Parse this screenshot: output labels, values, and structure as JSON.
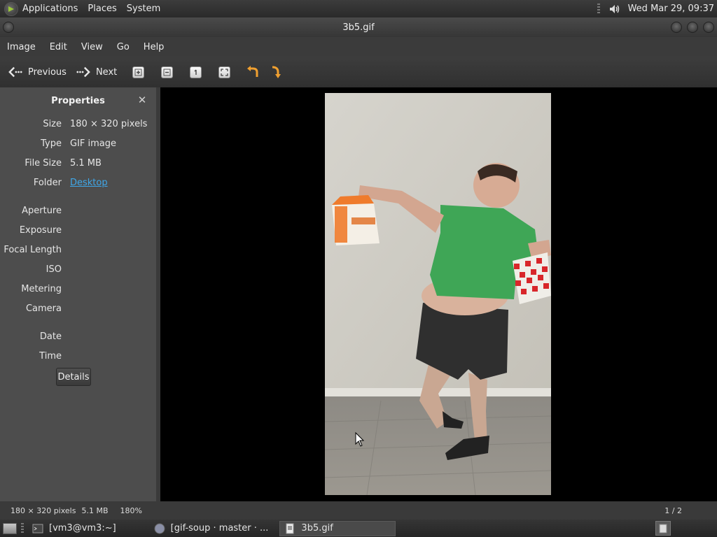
{
  "top_panel": {
    "menus": [
      "Applications",
      "Places",
      "System"
    ],
    "clock": "Wed Mar 29, 09:37"
  },
  "window": {
    "title": "3b5.gif"
  },
  "menubar": [
    "Image",
    "Edit",
    "View",
    "Go",
    "Help"
  ],
  "toolbar": {
    "previous_label": "Previous",
    "next_label": "Next"
  },
  "sidebar": {
    "header": "Properties",
    "properties": [
      {
        "key": "Size",
        "value": "180 × 320 pixels"
      },
      {
        "key": "Type",
        "value": "GIF image"
      },
      {
        "key": "File Size",
        "value": "5.1 MB"
      },
      {
        "key": "Folder",
        "value": "Desktop"
      },
      {
        "key": "Aperture",
        "value": ""
      },
      {
        "key": "Exposure",
        "value": ""
      },
      {
        "key": "Focal Length",
        "value": ""
      },
      {
        "key": "ISO",
        "value": ""
      },
      {
        "key": "Metering",
        "value": ""
      },
      {
        "key": "Camera",
        "value": ""
      },
      {
        "key": "Date",
        "value": ""
      },
      {
        "key": "Time",
        "value": ""
      }
    ],
    "details_button": "Details"
  },
  "statusbar": {
    "dimensions": "180 × 320 pixels",
    "file_size": "5.1 MB",
    "zoom": "180%",
    "page": "1 / 2"
  },
  "taskbar": {
    "tasks": [
      {
        "label": "[vm3@vm3:~]",
        "icon": "terminal-icon",
        "active": false
      },
      {
        "label": "[gif-soup · master · ...",
        "icon": "browser-icon",
        "active": false
      },
      {
        "label": "3b5.gif",
        "icon": "image-viewer-icon",
        "active": true
      }
    ]
  },
  "colors": {
    "accent_link": "#3fa7e8",
    "sidebar_bg": "#4d4d4d",
    "viewer_bg": "#000000"
  }
}
